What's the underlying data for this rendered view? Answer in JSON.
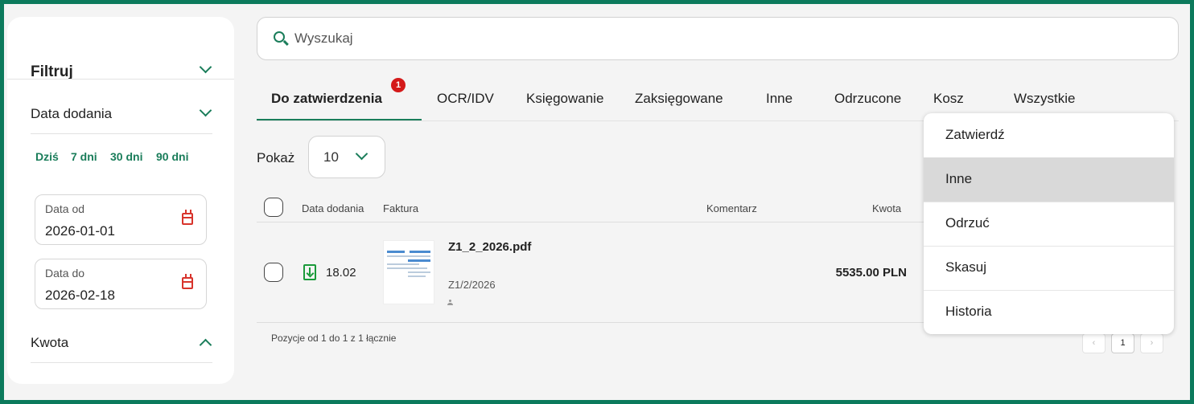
{
  "sidebar": {
    "title": "Filtruj",
    "date_section": "Data dodania",
    "quick_ranges": [
      "Dziś",
      "7 dni",
      "30 dni",
      "90 dni"
    ],
    "date_from": {
      "label": "Data od",
      "value": "2026-01-01"
    },
    "date_to": {
      "label": "Data do",
      "value": "2026-02-18"
    },
    "amount_section": "Kwota"
  },
  "search": {
    "placeholder": "Wyszukaj"
  },
  "tabs": [
    {
      "label": "Do zatwierdzenia",
      "badge": "1",
      "active": true
    },
    {
      "label": "OCR/IDV"
    },
    {
      "label": "Księgowanie"
    },
    {
      "label": "Zaksięgowane"
    },
    {
      "label": "Inne"
    },
    {
      "label": "Odrzucone"
    },
    {
      "label": "Kosz"
    },
    {
      "label": "Wszystkie"
    }
  ],
  "show": {
    "label": "Pokaż",
    "value": "10"
  },
  "table": {
    "headers": {
      "date": "Data dodania",
      "invoice": "Faktura",
      "comment": "Komentarz",
      "amount": "Kwota"
    },
    "rows": [
      {
        "date": "18.02",
        "file": "Z1_2_2026.pdf",
        "number": "Z1/2/2026",
        "amount": "5535.00 PLN"
      }
    ],
    "footer": "Pozycje od 1 do 1 z 1 łącznie",
    "page": "1"
  },
  "menu": {
    "items": [
      "Zatwierdź",
      "Inne",
      "Odrzuć",
      "Skasuj",
      "Historia"
    ],
    "hovered": "Inne"
  },
  "colors": {
    "accent": "#1a7d5a",
    "frame": "#0c7a5c",
    "badge": "#d41a1a",
    "calendar": "#d8342c"
  }
}
